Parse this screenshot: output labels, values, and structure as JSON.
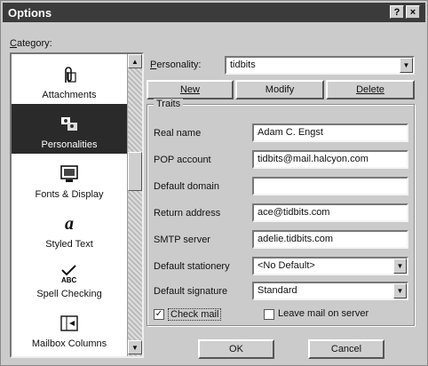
{
  "window": {
    "title": "Options",
    "help_label": "?",
    "close_label": "×"
  },
  "category": {
    "label": "Category:",
    "items": [
      {
        "label": "Attachments",
        "icon": "paperclip-icon"
      },
      {
        "label": "Personalities",
        "icon": "personalities-icon",
        "selected": true
      },
      {
        "label": "Fonts & Display",
        "icon": "monitor-icon"
      },
      {
        "label": "Styled Text",
        "icon": "styled-text-icon"
      },
      {
        "label": "Spell Checking",
        "icon": "spell-check-icon"
      },
      {
        "label": "Mailbox Columns",
        "icon": "columns-icon"
      }
    ]
  },
  "personality": {
    "label": "Personality:",
    "value": "tidbits",
    "new_label": "New",
    "modify_label": "Modify",
    "delete_label": "Delete"
  },
  "traits": {
    "title": "Traits",
    "real_name": {
      "label": "Real name",
      "value": "Adam C. Engst"
    },
    "pop_account": {
      "label": "POP account",
      "value": "tidbits@mail.halcyon.com"
    },
    "default_domain": {
      "label": "Default domain",
      "value": ""
    },
    "return_address": {
      "label": "Return address",
      "value": "ace@tidbits.com"
    },
    "smtp_server": {
      "label": "SMTP server",
      "value": "adelie.tidbits.com"
    },
    "default_stationery": {
      "label": "Default stationery",
      "value": "<No Default>"
    },
    "default_signature": {
      "label": "Default signature",
      "value": "Standard"
    },
    "check_mail": {
      "label": "Check mail",
      "checked": true
    },
    "leave_mail": {
      "label": "Leave mail on server",
      "checked": false
    }
  },
  "buttons": {
    "ok": "OK",
    "cancel": "Cancel"
  },
  "colors": {
    "titlebar": "#3b3b3b",
    "selection": "#2a2a2a",
    "face": "#cbcbcb"
  }
}
